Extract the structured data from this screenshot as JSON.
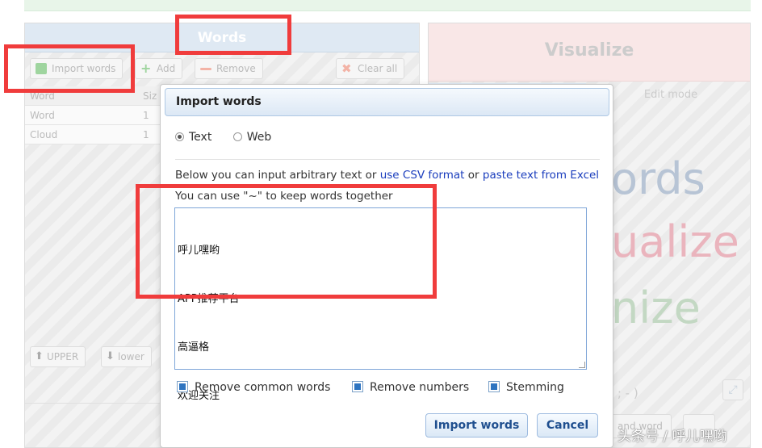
{
  "left_panel": {
    "title": "Words",
    "toolbar": {
      "import_label": "Import words",
      "add_label": "Add",
      "remove_label": "Remove",
      "clear_label": "Clear all"
    },
    "table_header_word": "Word",
    "table_header_size": "Siz",
    "rows": [
      {
        "word": "Word",
        "size": "1"
      },
      {
        "word": "Cloud",
        "size": "1"
      }
    ],
    "upper_label": "UPPER",
    "lower_label": "lower"
  },
  "right_panel": {
    "title": "Visualize",
    "edit_mode_label": "Edit mode",
    "cloud_words": [
      "ords",
      "ualize",
      "nize"
    ],
    "smiley": "; ; - )",
    "bottom_label": "and word"
  },
  "dialog": {
    "title": "Import words",
    "radio_text": "Text",
    "radio_web": "Web",
    "info_prefix": "Below you can input arbitrary text or ",
    "info_link1": "use CSV format",
    "info_mid": " or ",
    "info_link2": "paste text from Excel",
    "info_line2": "You can use \"~\" to keep words together",
    "textarea_lines": [
      "呼儿嘿哟",
      "APP推荐平台",
      "高逼格",
      "欢迎关注"
    ],
    "check_common": "Remove common words",
    "check_numbers": "Remove numbers",
    "check_stemming": "Stemming",
    "import_button": "Import words",
    "cancel_button": "Cancel"
  },
  "watermark": "头条号 / 呼儿嘿哟",
  "colors": {
    "highlight": "#f03c3c",
    "link": "#1a3dbd",
    "button_text": "#1f4f8f"
  }
}
